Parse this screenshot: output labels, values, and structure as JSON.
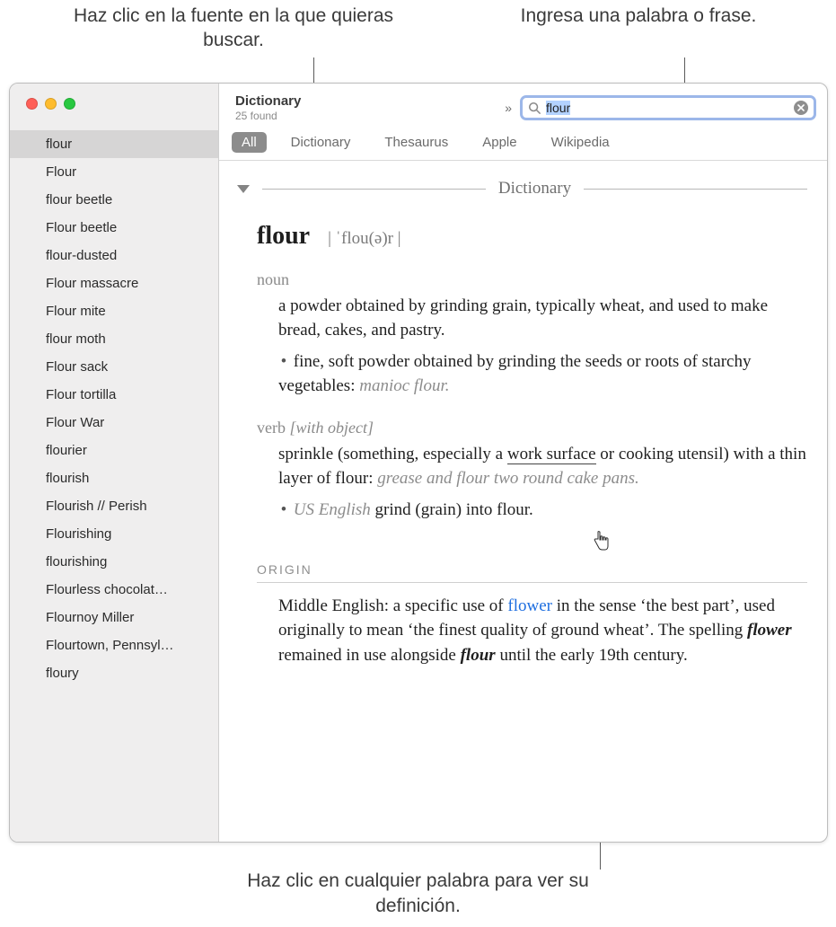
{
  "callouts": {
    "top_left": "Haz clic en la fuente en la que quieras buscar.",
    "top_right": "Ingresa una palabra o frase.",
    "bottom": "Haz clic en cualquier palabra para ver su definición."
  },
  "header": {
    "app_title": "Dictionary",
    "result_count": "25 found",
    "search_value": "flour"
  },
  "tabs": [
    "All",
    "Dictionary",
    "Thesaurus",
    "Apple",
    "Wikipedia"
  ],
  "active_tab": "All",
  "sidebar_items": [
    "flour",
    "Flour",
    "flour beetle",
    "Flour beetle",
    "flour-dusted",
    "Flour massacre",
    "Flour mite",
    "flour moth",
    "Flour sack",
    "Flour tortilla",
    "Flour War",
    "flourier",
    "flourish",
    "Flourish // Perish",
    "Flourishing",
    "flourishing",
    "Flourless chocolat…",
    "Flournoy Miller",
    "Flourtown, Pennsyl…",
    "floury"
  ],
  "selected_index": 0,
  "section_label": "Dictionary",
  "entry": {
    "headword": "flour",
    "pronunciation": "| ˈflou(ə)r |",
    "pos1": "noun",
    "def1": "a powder obtained by grinding grain, typically wheat, and used to make bread, cakes, and pastry",
    "sub1_lead": "fine, soft powder obtained by grinding the seeds or roots of starchy vegetables",
    "sub1_example": "manioc flour.",
    "pos2": "verb",
    "pos2_qual": "[with object]",
    "def2_pre": "sprinkle (something, especially a ",
    "def2_xref": "work surface",
    "def2_post": " or cooking utensil) with a thin layer of flour",
    "def2_example": "grease and flour two round cake pans.",
    "sub2_qual": "US English",
    "sub2_text": "grind (grain) into flour",
    "origin_label": "ORIGIN",
    "origin_pre": "Middle English: a specific use of ",
    "origin_link": "flower",
    "origin_mid": " in the sense ‘the best part’, used originally to mean ‘the finest quality of ground wheat’. The spelling ",
    "origin_bi1": "flower",
    "origin_mid2": " remained in use alongside ",
    "origin_bi2": "flour",
    "origin_end": " until the early 19th century."
  }
}
